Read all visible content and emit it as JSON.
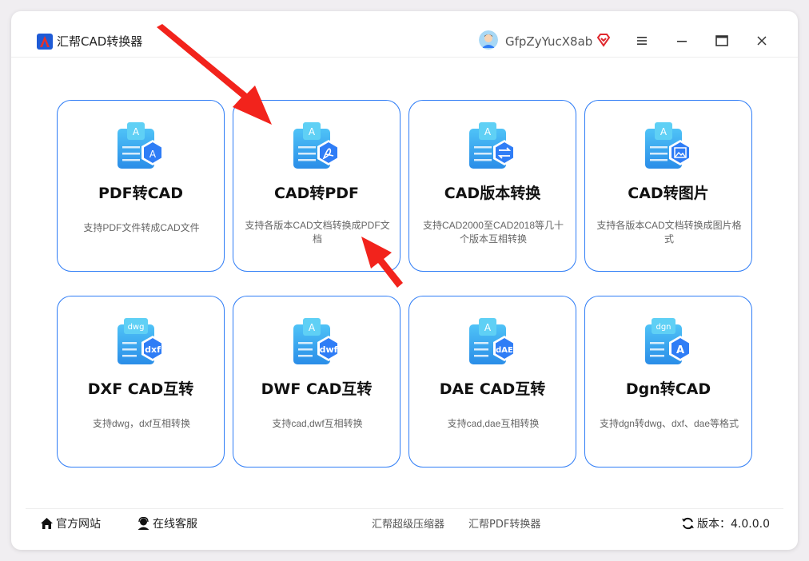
{
  "app": {
    "title": "汇帮CAD转换器"
  },
  "user": {
    "name": "GfpZyYucX8ab"
  },
  "cards": [
    {
      "title": "PDF转CAD",
      "desc": "支持PDF文件转成CAD文件"
    },
    {
      "title": "CAD转PDF",
      "desc": "支持各版本CAD文档转换成PDF文档"
    },
    {
      "title": "CAD版本转换",
      "desc": "支持CAD2000至CAD2018等几十个版本互相转换"
    },
    {
      "title": "CAD转图片",
      "desc": "支持各版本CAD文档转换成图片格式"
    },
    {
      "title": "DXF CAD互转",
      "desc": "支持dwg，dxf互相转换",
      "badge": "dwg",
      "badge_text": "dxf"
    },
    {
      "title": "DWF CAD互转",
      "desc": "支持cad,dwf互相转换",
      "badge_text": "dwf"
    },
    {
      "title": "DAE CAD互转",
      "desc": "支持cad,dae互相转换",
      "badge_text": "dAE"
    },
    {
      "title": "Dgn转CAD",
      "desc": "支持dgn转dwg、dxf、dae等格式",
      "badge": "dgn",
      "badge_text": "A"
    }
  ],
  "footer": {
    "website": "官方网站",
    "support": "在线客服",
    "link1": "汇帮超级压缩器",
    "link2": "汇帮PDF转换器",
    "version_label": "版本：4.0.0.0"
  },
  "colors": {
    "accent": "#2f7df6",
    "arrow": "#f2231c"
  }
}
